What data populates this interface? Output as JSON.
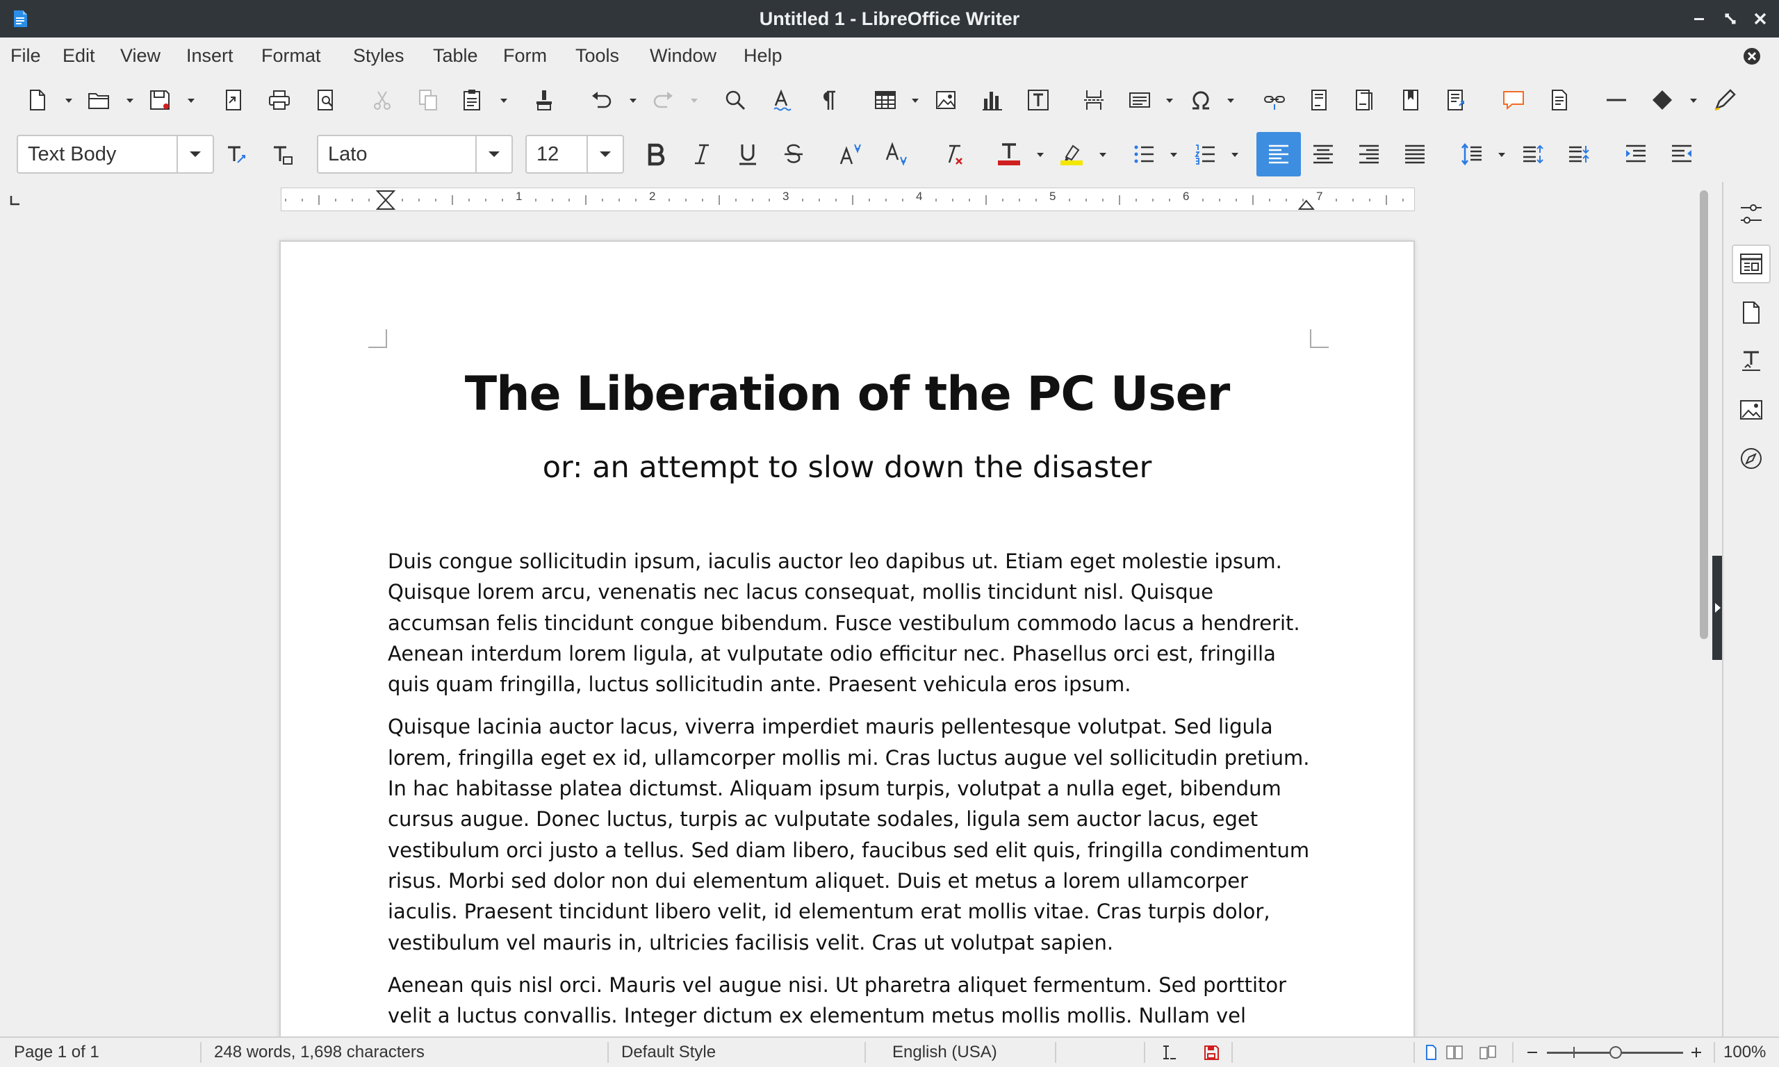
{
  "window": {
    "title": "Untitled 1 - LibreOffice Writer"
  },
  "menu": [
    "File",
    "Edit",
    "View",
    "Insert",
    "Format",
    "Styles",
    "Table",
    "Form",
    "Tools",
    "Window",
    "Help"
  ],
  "formatting": {
    "paragraph_style": "Text Body",
    "font_name": "Lato",
    "font_size": "12",
    "font_color": "#d01f1f",
    "highlight_color": "#f3e600",
    "accent_color": "#3d8ee0"
  },
  "ruler": {
    "numbers": [
      "1",
      "2",
      "3",
      "4",
      "5",
      "6",
      "7"
    ]
  },
  "document": {
    "title": "The Liberation of the PC User",
    "subtitle": "or: an attempt to slow down the disaster",
    "paragraphs": [
      "Duis congue sollicitudin ipsum, iaculis auctor leo dapibus ut. Etiam eget molestie ipsum. Quisque lorem arcu, venenatis nec lacus consequat, mollis tincidunt nisl. Quisque accumsan felis tincidunt congue bibendum. Fusce vestibulum commodo lacus a hendrerit. Aenean interdum lorem ligula, at vulputate odio efficitur nec. Phasellus orci est, fringilla quis quam fringilla, luctus sollicitudin ante. Praesent vehicula eros ipsum.",
      "Quisque lacinia auctor lacus, viverra imperdiet mauris pellentesque volutpat. Sed ligula lorem, fringilla eget ex id, ullamcorper mollis mi. Cras luctus augue vel sollicitudin pretium. In hac habitasse platea dictumst. Aliquam ipsum turpis, volutpat a nulla eget, bibendum cursus augue. Donec luctus, turpis ac vulputate sodales, ligula sem auctor lacus, eget vestibulum orci justo a tellus. Sed diam libero, faucibus sed elit quis, fringilla condimentum risus. Morbi sed dolor non dui elementum aliquet. Duis et metus a lorem ullamcorper iaculis. Praesent tincidunt libero velit, id elementum erat mollis vitae. Cras turpis dolor, vestibulum vel mauris in, ultricies facilisis velit. Cras ut volutpat sapien.",
      "Aenean quis nisl orci. Mauris vel augue nisi. Ut pharetra aliquet fermentum. Sed porttitor velit a luctus convallis. Integer dictum ex elementum metus mollis mollis. Nullam vel mauris purus."
    ]
  },
  "status": {
    "page": "Page 1 of 1",
    "word_count": "248 words, 1,698 characters",
    "page_style": "Default Style",
    "language": "English (USA)",
    "zoom": "100%"
  }
}
